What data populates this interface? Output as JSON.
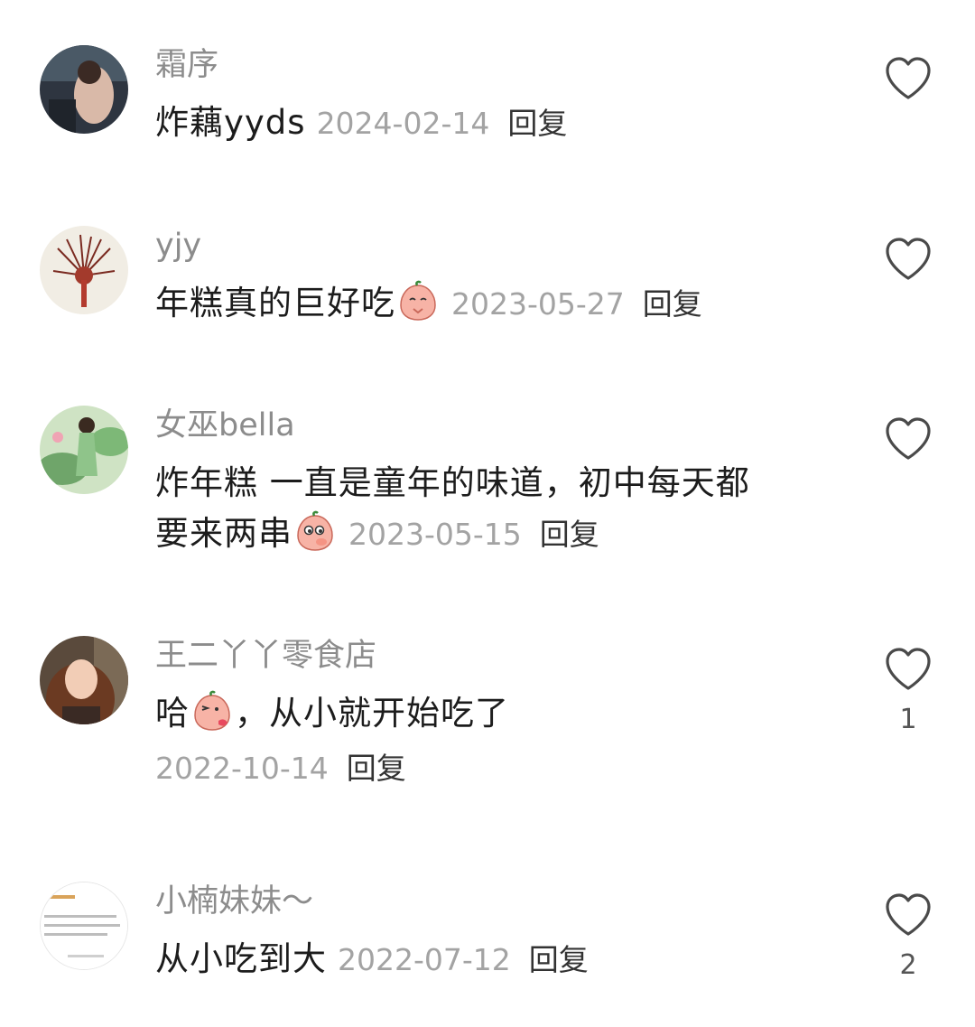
{
  "comments": [
    {
      "username": "霜序",
      "avatar_icon": "avatar-woman-dark-room",
      "text": "炸藕yyds",
      "date": "2024-02-14",
      "reply_label": "回复",
      "like_count": ""
    },
    {
      "username": "yjy",
      "avatar_icon": "avatar-red-flower-illustration",
      "text": "年糕真的巨好吃",
      "emoji": "peach-praying-emoji",
      "date": "2023-05-27",
      "reply_label": "回复",
      "like_count": ""
    },
    {
      "username": "女巫bella",
      "avatar_icon": "avatar-girl-lotus-illustration",
      "text_line1": "炸年糕 一直是童年的味道，初中每天都",
      "text_line2": "要来两串",
      "emoji": "peach-thinking-emoji",
      "date": "2023-05-15",
      "reply_label": "回复",
      "like_count": ""
    },
    {
      "username": "王二丫丫零食店",
      "avatar_icon": "avatar-woman-portrait",
      "text_prefix": "哈",
      "text_suffix": "，从小就开始吃了",
      "emoji": "peach-kiss-emoji",
      "date": "2022-10-14",
      "reply_label": "回复",
      "like_count": "1"
    },
    {
      "username": "小楠妹妹～",
      "avatar_icon": "avatar-text-screenshot",
      "text": "从小吃到大",
      "date": "2022-07-12",
      "reply_label": "回复",
      "like_count": "2"
    }
  ],
  "colors": {
    "username": "#8c8c8c",
    "date": "#a3a3a3",
    "body": "#1c1c1c",
    "heart_outline": "#4a4a4a",
    "emoji_peach": "#f4a79a"
  }
}
